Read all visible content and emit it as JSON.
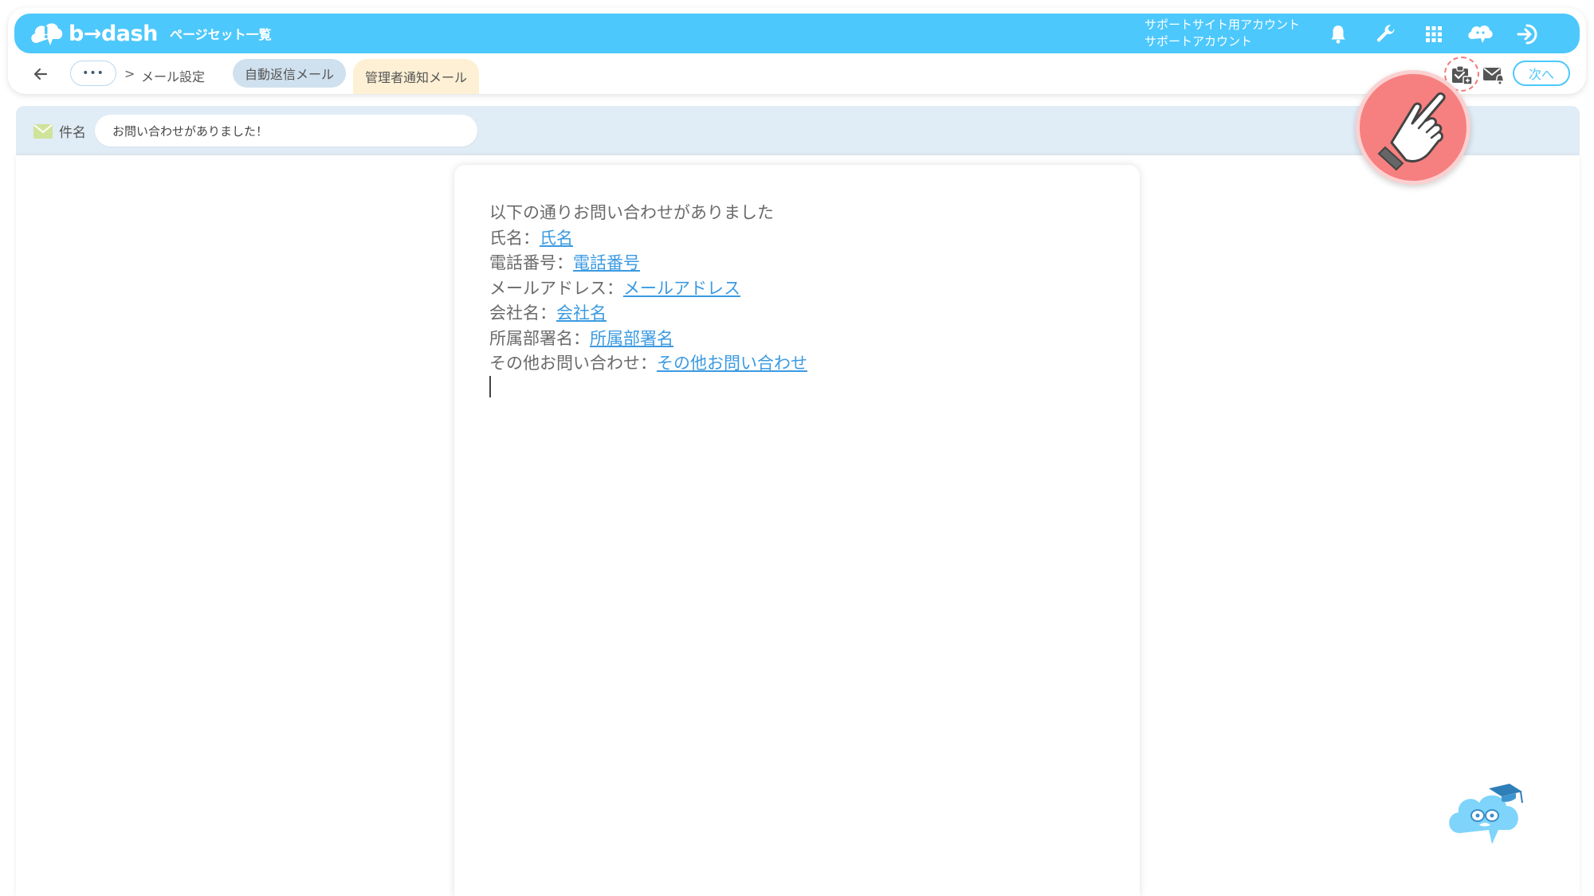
{
  "header": {
    "logo_text": "b→dash",
    "pageset_link": "ページセット一覧",
    "account_line1": "サポートサイト用アカウント",
    "account_line2": "サポートアカウント",
    "icons": [
      "bell-icon",
      "wrench-icon",
      "grid-icon",
      "cloud-chat-icon",
      "logout-icon"
    ]
  },
  "subbar": {
    "more_label": "•••",
    "separator": ">",
    "breadcrumb_mail": "メール設定",
    "tab_auto_reply": "自動返信メール",
    "tab_admin_notice": "管理者通知メール",
    "next_label": "次へ"
  },
  "subject": {
    "label": "件名",
    "value": "お問い合わせがありました！"
  },
  "body": {
    "intro": "以下の通りお問い合わせがありました",
    "lines": [
      {
        "label": "氏名：",
        "var": "氏名"
      },
      {
        "label": "電話番号：",
        "var": "電話番号"
      },
      {
        "label": "メールアドレス：",
        "var": "メールアドレス"
      },
      {
        "label": "会社名：",
        "var": "会社名"
      },
      {
        "label": "所属部署名：",
        "var": "所属部署名"
      },
      {
        "label": "その他お問い合わせ：",
        "var": "その他お問い合わせ"
      }
    ]
  },
  "colors": {
    "brand": "#4dc8fc",
    "link": "#3b9ae1",
    "highlight": "#f67f7f",
    "admin_tab": "#fdf0d4",
    "auto_tab": "#cfe0ee"
  }
}
